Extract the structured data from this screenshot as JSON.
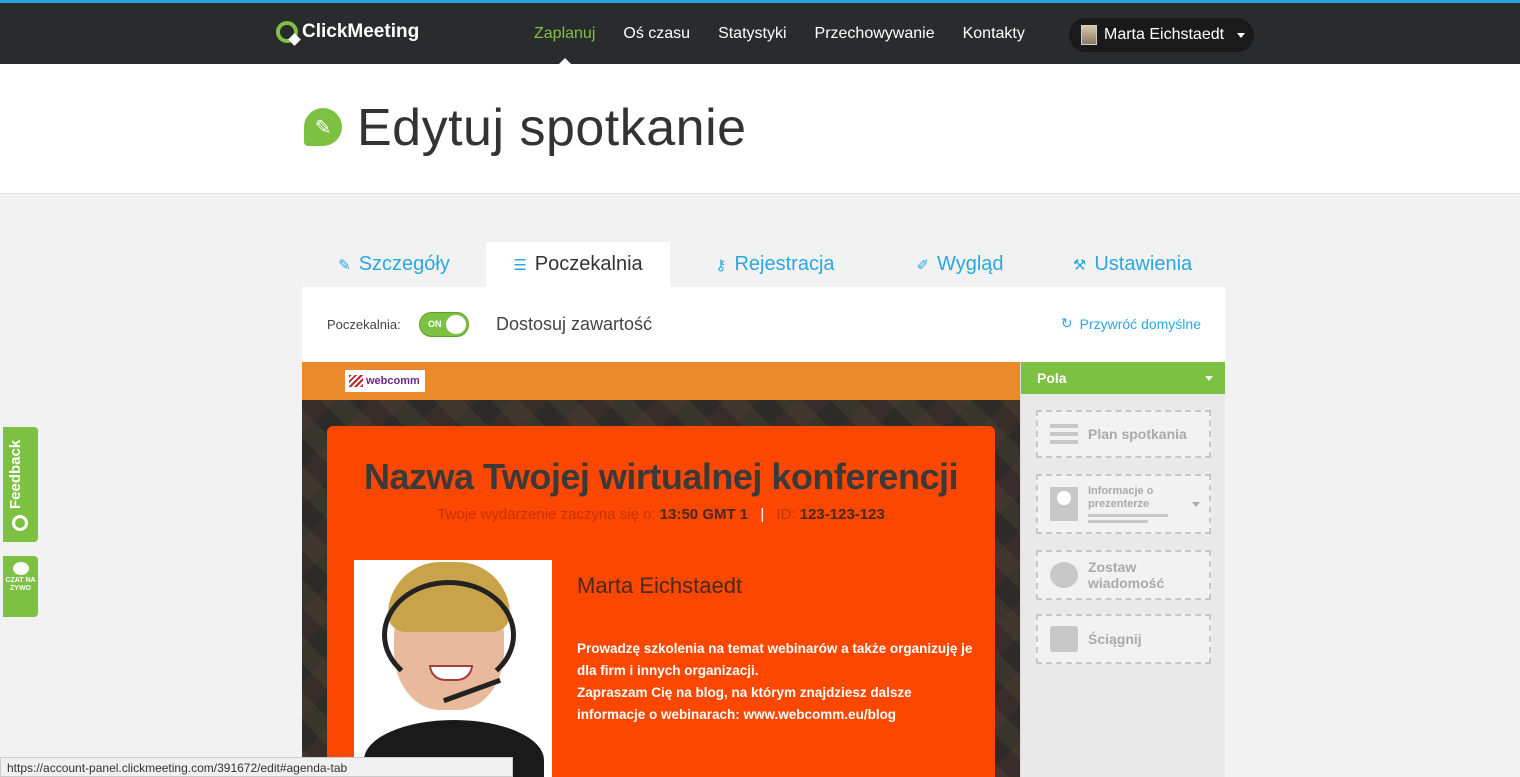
{
  "brand": {
    "name": "ClickMeeting",
    "accent": "#7cc142",
    "link": "#29a8e0"
  },
  "nav": {
    "items": [
      {
        "label": "Zaplanuj",
        "active": true
      },
      {
        "label": "Oś czasu"
      },
      {
        "label": "Statystyki"
      },
      {
        "label": "Przechowywanie"
      },
      {
        "label": "Kontakty"
      }
    ],
    "user": "Marta Eichstaedt"
  },
  "header": {
    "title": "Edytuj spotkanie"
  },
  "tabs": [
    {
      "label": "Szczegóły",
      "icon": "pencil-icon"
    },
    {
      "label": "Poczekalnia",
      "icon": "list-icon",
      "active": true
    },
    {
      "label": "Rejestracja",
      "icon": "key-icon"
    },
    {
      "label": "Wygląd",
      "icon": "brush-icon"
    },
    {
      "label": "Ustawienia",
      "icon": "wrench-icon"
    }
  ],
  "toolbar": {
    "waiting_room_label": "Poczekalnia:",
    "toggle_state": "ON",
    "customize_label": "Dostosuj zawartość",
    "restore_label": "Przywróć domyślne"
  },
  "preview": {
    "brand_logo_text": "webcomm",
    "title": "Nazwa Twojej wirtualnej konferencji",
    "starts_label": "Twoje wydarzenie zaczyna się o:",
    "starts_time": "13:50 GMT 1",
    "id_label": "ID:",
    "id_value": "123-123-123",
    "presenter_name": "Marta Eichstaedt",
    "bio_line1": "Prowadzę szkolenia na temat webinarów a także organizuję je dla firm i innych organizacji.",
    "bio_line2": "Zapraszam Cię na blog, na którym znajdziesz dalsze informacje o webinarach: www.webcomm.eu/blog"
  },
  "sidebar": {
    "header": "Pola",
    "fields": [
      {
        "label": "Plan spotkania"
      },
      {
        "label": "Informacje o prezenterze"
      },
      {
        "label": "Zostaw wiadomość"
      },
      {
        "label": "Ściągnij"
      }
    ]
  },
  "widgets": {
    "feedback": "Feedback",
    "chat": "CZAT NA ŻYWO"
  },
  "status_url": "https://account-panel.clickmeeting.com/391672/edit#agenda-tab"
}
